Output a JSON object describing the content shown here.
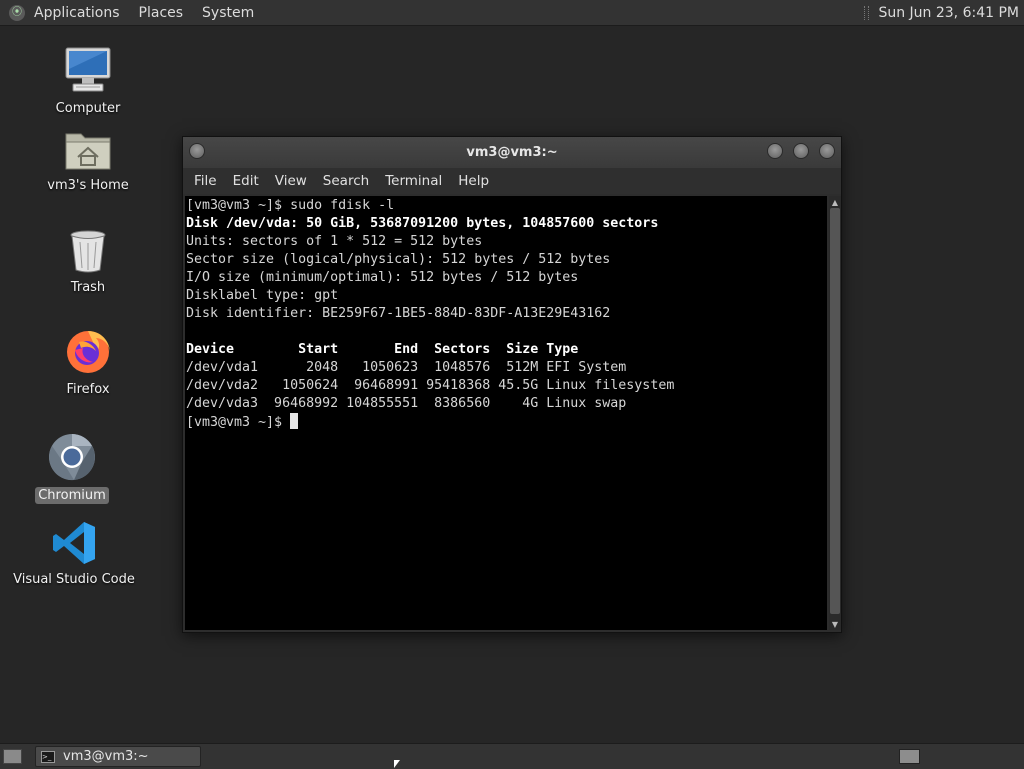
{
  "top_panel": {
    "menus": [
      "Applications",
      "Places",
      "System"
    ],
    "clock": "Sun Jun 23,  6:41 PM"
  },
  "desktop_icons": [
    {
      "label": "Computer",
      "icon": "computer-monitor-icon"
    },
    {
      "label": "vm3's Home",
      "icon": "home-folder-icon"
    },
    {
      "label": "Trash",
      "icon": "trash-icon"
    },
    {
      "label": "Firefox",
      "icon": "firefox-icon"
    },
    {
      "label": "Chromium",
      "icon": "chromium-icon",
      "selected": true
    },
    {
      "label": "Visual Studio Code",
      "icon": "vscode-icon"
    }
  ],
  "terminal": {
    "title": "vm3@vm3:~",
    "menu": [
      "File",
      "Edit",
      "View",
      "Search",
      "Terminal",
      "Help"
    ],
    "lines": [
      {
        "text": "[vm3@vm3 ~]$ sudo fdisk -l",
        "bold": false
      },
      {
        "text": "Disk /dev/vda: 50 GiB, 53687091200 bytes, 104857600 sectors",
        "bold": true
      },
      {
        "text": "Units: sectors of 1 * 512 = 512 bytes",
        "bold": false
      },
      {
        "text": "Sector size (logical/physical): 512 bytes / 512 bytes",
        "bold": false
      },
      {
        "text": "I/O size (minimum/optimal): 512 bytes / 512 bytes",
        "bold": false
      },
      {
        "text": "Disklabel type: gpt",
        "bold": false
      },
      {
        "text": "Disk identifier: BE259F67-1BE5-884D-83DF-A13E29E43162",
        "bold": false
      },
      {
        "text": "",
        "bold": false
      },
      {
        "text": "Device        Start       End  Sectors  Size Type",
        "bold": true
      },
      {
        "text": "/dev/vda1      2048   1050623  1048576  512M EFI System",
        "bold": false
      },
      {
        "text": "/dev/vda2   1050624  96468991 95418368 45.5G Linux filesystem",
        "bold": false
      },
      {
        "text": "/dev/vda3  96468992 104855551  8386560    4G Linux swap",
        "bold": false
      }
    ],
    "prompt": "[vm3@vm3 ~]$ "
  },
  "taskbar": {
    "window_button": "vm3@vm3:~"
  },
  "colors": {
    "desktop_bg": "#262626",
    "panel_bg": "#333333",
    "terminal_bg": "#000000",
    "terminal_fg": "#d6d6d6"
  }
}
